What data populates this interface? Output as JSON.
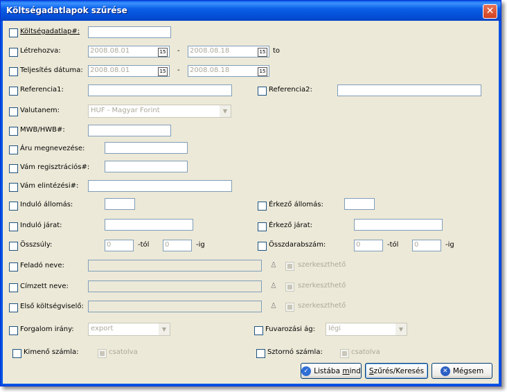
{
  "window": {
    "title": "Költségadatlapok szűrése",
    "close_glyph": "✕"
  },
  "fields": {
    "koltsegadatlap": {
      "label": "Költségadatlap#:",
      "value": ""
    },
    "letrehozva": {
      "label": "Létrehozva:",
      "from": "2008.08.01",
      "to": "2008.08.18",
      "dash": "-",
      "suffix": "to"
    },
    "teljesites": {
      "label": "Teljesítés dátuma:",
      "from": "2008.08.01",
      "to": "2008.08.18",
      "dash": "-"
    },
    "calendar_glyph": "15",
    "referencia1": {
      "label": "Referencia1:",
      "value": ""
    },
    "referencia2": {
      "label": "Referencia2:",
      "value": ""
    },
    "valutanem": {
      "label": "Valutanem:",
      "selected": "HUF - Magyar Forint"
    },
    "mwb": {
      "label": "MWB/HWB#:",
      "value": ""
    },
    "aru": {
      "label": "Áru megnevezése:",
      "value": ""
    },
    "vam_reg": {
      "label": "Vám regisztrációs#:",
      "value": ""
    },
    "vam_elint": {
      "label": "Vám elintézési#:",
      "value": ""
    },
    "indulo_allomas": {
      "label": "Induló állomás:",
      "value": ""
    },
    "erkezo_allomas": {
      "label": "Érkező állomás:",
      "value": ""
    },
    "indulo_jarat": {
      "label": "Induló járat:",
      "value": ""
    },
    "erkezo_jarat": {
      "label": "Érkező járat:",
      "value": ""
    },
    "osszsuly": {
      "label": "Összsúly:",
      "from": "0",
      "from_suffix": "-tól",
      "to": "0",
      "to_suffix": "-ig"
    },
    "osszdarab": {
      "label": "Összdarabszám:",
      "from": "0",
      "from_suffix": "-tól",
      "to": "0",
      "to_suffix": "-ig"
    },
    "felado": {
      "label": "Feladó neve:",
      "value": "",
      "editable_label": "szerkeszthető"
    },
    "cimzett": {
      "label": "Címzett neve:",
      "value": "",
      "editable_label": "szerkeszthető"
    },
    "elso_koltseg": {
      "label": "Első költségviselő:",
      "value": "",
      "editable_label": "szerkeszthető"
    },
    "forgalom": {
      "label": "Forgalom irány:",
      "selected": "export"
    },
    "fuvarozasi": {
      "label": "Fuvarozási ág:",
      "selected": "légi"
    },
    "kimeno": {
      "label": "Kimenő számla:",
      "attached_label": "csatolva"
    },
    "sztorno": {
      "label": "Sztornó számla:",
      "attached_label": "csatolva"
    }
  },
  "buttons": {
    "list_all": {
      "pre": "Listába ",
      "u": "m",
      "post": "ind"
    },
    "filter": {
      "pre": "",
      "u": "S",
      "post": "zűrés/Keresés"
    },
    "cancel": {
      "label": "Mégsem"
    }
  },
  "colors": {
    "title_bar": "#0a5fe6",
    "dialog_bg": "#ece9d8",
    "field_border": "#7f9db9"
  }
}
